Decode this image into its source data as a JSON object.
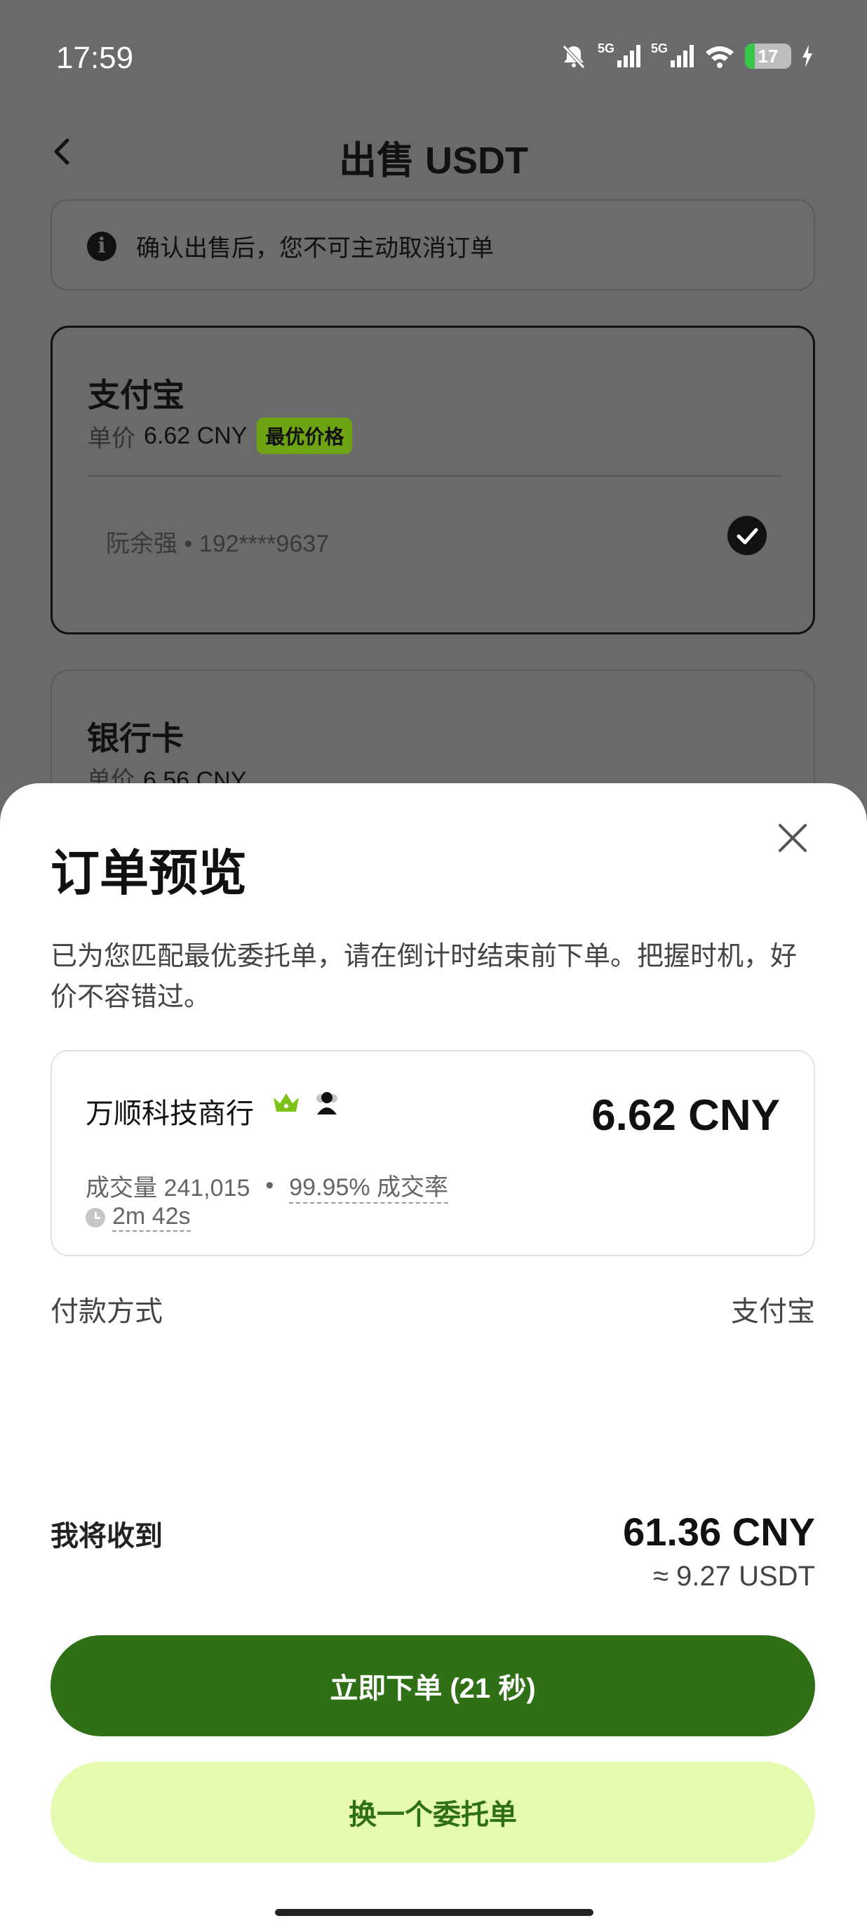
{
  "status_bar": {
    "time": "17:59",
    "signal_labels": [
      "5G",
      "5G"
    ],
    "battery_level": "17"
  },
  "header": {
    "title": "出售 USDT"
  },
  "notice": {
    "text": "确认出售后，您不可主动取消订单"
  },
  "payment_methods": {
    "alipay": {
      "name": "支付宝",
      "price_label": "单价",
      "price_value": "6.62 CNY",
      "badge": "最优价格",
      "account": "阮余强  •  192****9637",
      "selected": true
    },
    "bank": {
      "name": "银行卡",
      "price_label": "单价",
      "price_value": "6.56 CNY"
    }
  },
  "sheet": {
    "title": "订单预览",
    "description": "已为您匹配最优委托单，请在倒计时结束前下单。把握时机，好价不容错过。",
    "merchant": {
      "name": "万顺科技商行",
      "price": "6.62 CNY",
      "volume": "成交量 241,015",
      "separator": "•",
      "completion_rate": "99.95% 成交率",
      "duration": "2m 42s"
    },
    "payment_method": {
      "label": "付款方式",
      "value": "支付宝"
    },
    "receive": {
      "label": "我将收到",
      "amount": "61.36 CNY",
      "approx": "≈ 9.27 USDT"
    },
    "buttons": {
      "primary": "立即下单 (21 秒)",
      "secondary": "换一个委托单"
    }
  },
  "colors": {
    "primary_green": "#2f6f15",
    "light_green": "#e4fbb0",
    "badge_green": "#6ea313",
    "crown_green": "#7cc21a"
  }
}
